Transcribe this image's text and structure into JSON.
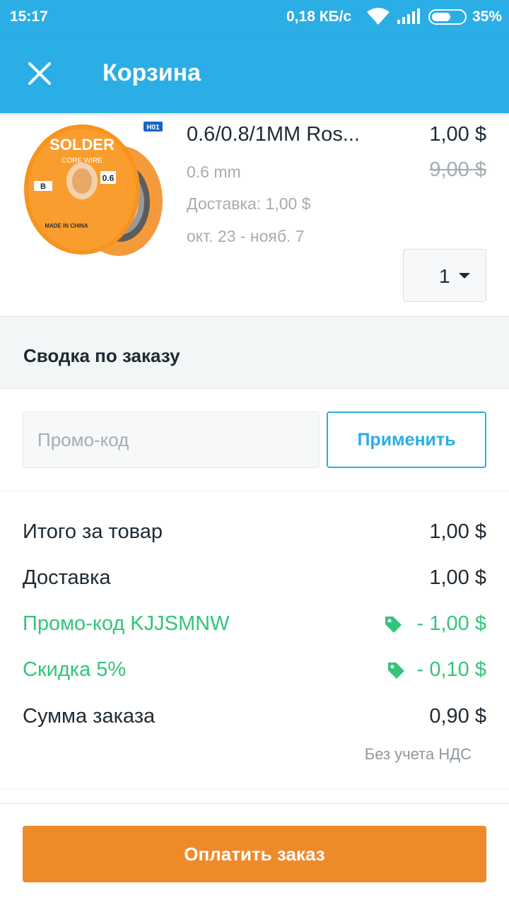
{
  "status_bar": {
    "time": "15:17",
    "network_speed": "0,18 КБ/с",
    "battery_percent": "35%",
    "icons": [
      "wifi-icon",
      "signal-icon",
      "battery-icon"
    ]
  },
  "app_bar": {
    "title": "Корзина",
    "close_icon": "close-icon"
  },
  "cart_item": {
    "name": "0.6/0.8/1MM Ros...",
    "variant": "0.6 mm",
    "shipping": "Доставка: 1,00 $",
    "delivery_dates": "окт. 23 - нояб. 7",
    "price": "1,00 $",
    "old_price": "9,00 $",
    "quantity": "1",
    "image_labels": {
      "brand": "SOLDER",
      "subtitle": "CORE WIRE",
      "badge": "H01",
      "letter": "B",
      "size": "0.6",
      "origin": "MADE IN CHINA"
    }
  },
  "summary": {
    "heading": "Сводка по заказу",
    "promo_placeholder": "Промо-код",
    "apply_label": "Применить",
    "rows": [
      {
        "label": "Итого за товар",
        "amount": "1,00 $"
      },
      {
        "label": "Доставка",
        "amount": "1,00 $"
      },
      {
        "label": "Промо-код KJJSMNW",
        "amount": "- 1,00 $"
      },
      {
        "label": "Скидка 5%",
        "amount": "- 0,10 $"
      },
      {
        "label": "Сумма заказа",
        "amount": "0,90 $"
      }
    ],
    "vat_note": "Без учета НДС"
  },
  "pay_button": "Оплатить заказ",
  "colors": {
    "accent_blue": "#2baee6",
    "discount_green": "#34c47c",
    "pay_orange": "#ef8a2b"
  }
}
